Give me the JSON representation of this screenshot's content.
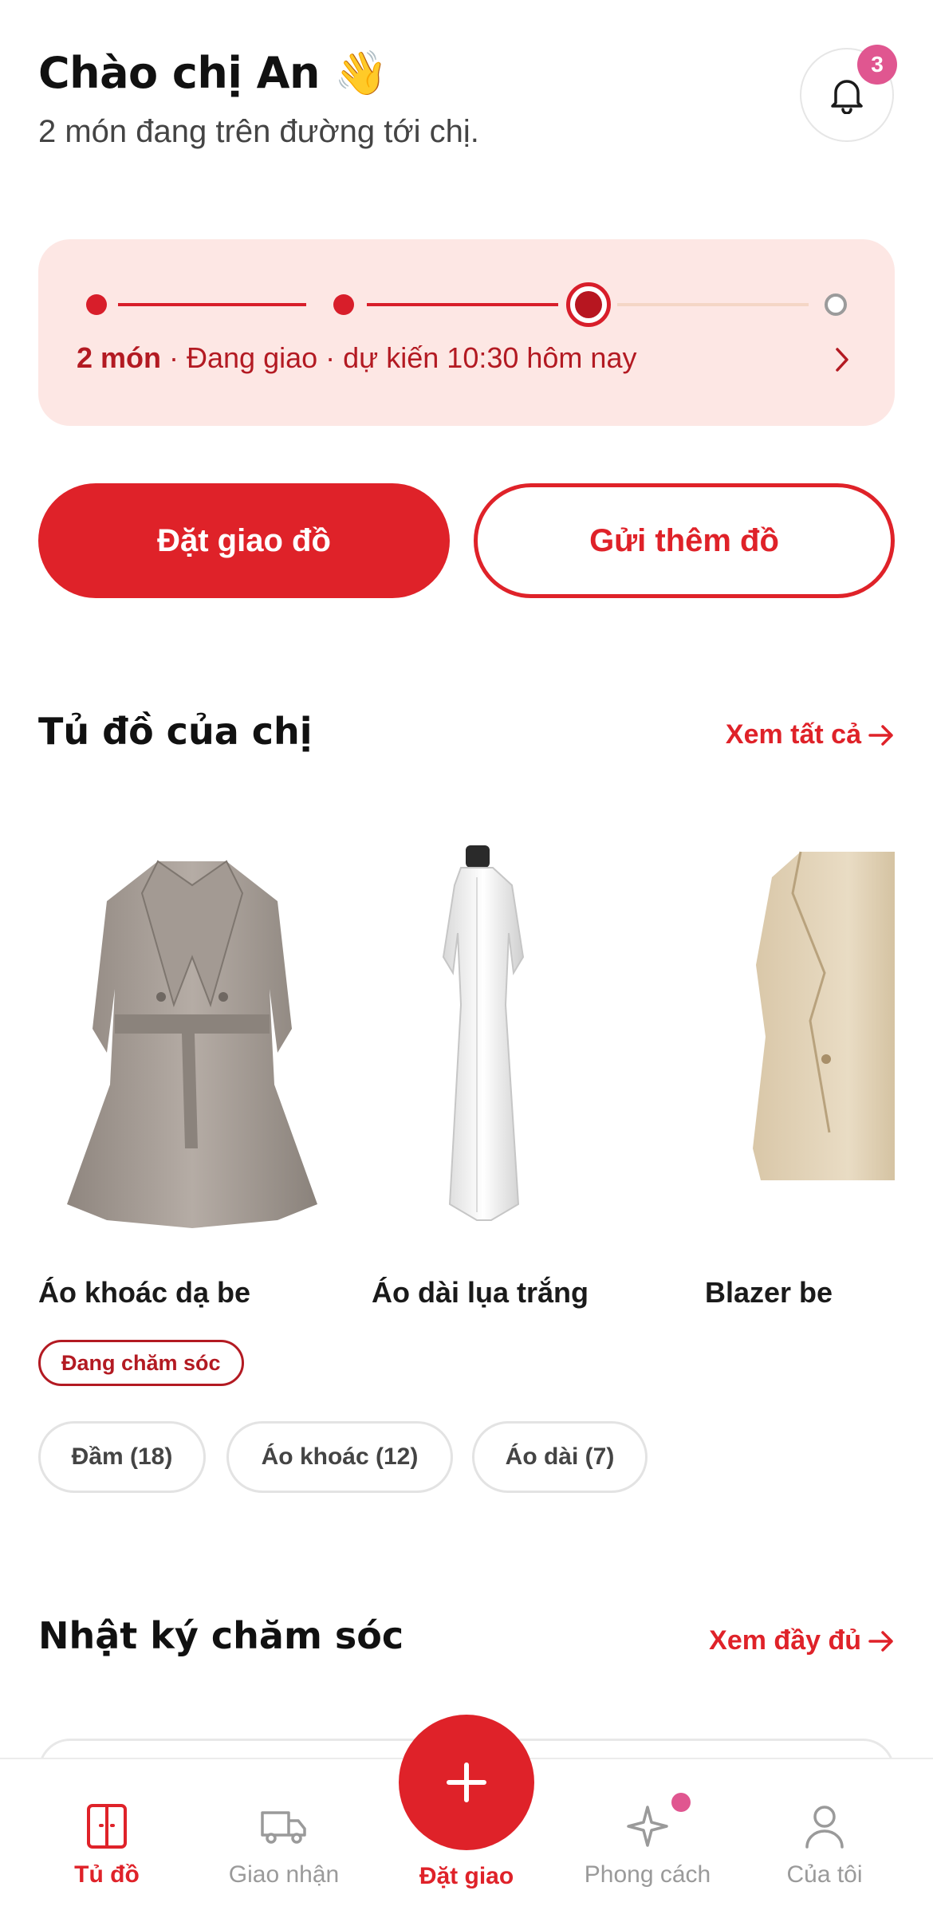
{
  "header": {
    "greeting": "Chào chị An 👋",
    "subtitle": "2 món đang trên đường tới chị.",
    "notification_count": "3"
  },
  "tracking": {
    "count_label": "2 món",
    "status_text": " · Đang giao · dự kiến 10:30 hôm nay",
    "step_current": 3,
    "step_total": 4
  },
  "actions": {
    "primary_label": "Đặt giao đồ",
    "secondary_label": "Gửi thêm đồ"
  },
  "wardrobe": {
    "title": "Tủ đồ của chị",
    "link_label": "Xem tất cả",
    "items": [
      {
        "name": "Áo khoác dạ be",
        "tag": "Đang chăm sóc"
      },
      {
        "name": "Áo dài lụa trắng"
      },
      {
        "name": "Blazer be"
      }
    ],
    "categories": [
      "Đầm (18)",
      "Áo khoác (12)",
      "Áo dài (7)"
    ]
  },
  "journal": {
    "title": "Nhật ký chăm sóc",
    "link_label": "Xem đầy đủ"
  },
  "nav": {
    "items": [
      {
        "label": "Tủ đồ",
        "icon": "wardrobe-icon",
        "active": true
      },
      {
        "label": "Giao nhận",
        "icon": "truck-icon",
        "active": false
      },
      {
        "label": "Đặt giao",
        "icon": "plus-icon",
        "active": true
      },
      {
        "label": "Phong cách",
        "icon": "sparkle-icon",
        "active": false
      },
      {
        "label": "Của tôi",
        "icon": "user-icon",
        "active": false
      }
    ]
  },
  "colors": {
    "accent": "#df2229",
    "accent_dark": "#b31a22",
    "tracking_bg": "#fde7e4",
    "badge": "#e05690"
  }
}
